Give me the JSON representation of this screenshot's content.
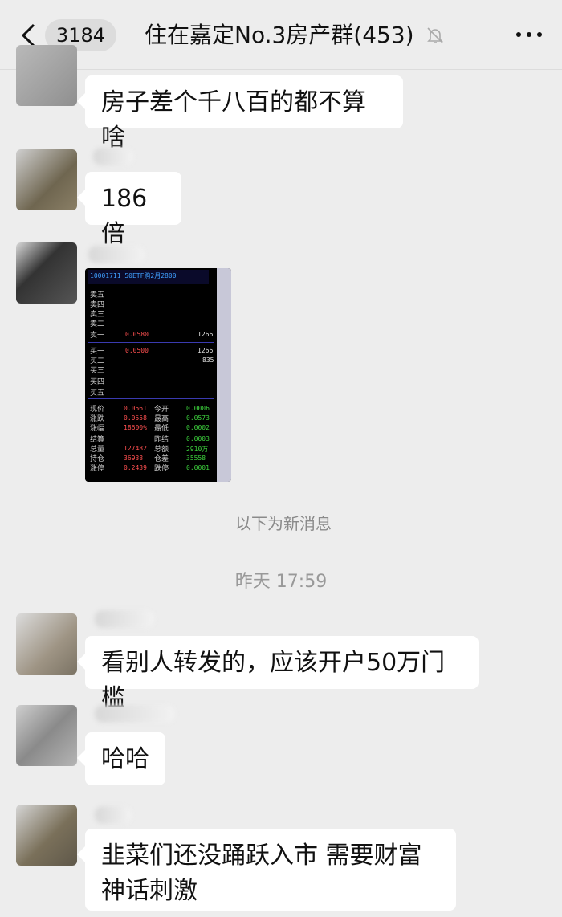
{
  "header": {
    "unread_count": "3184",
    "title": "住在嘉定No.3房产群(453)"
  },
  "messages_before": [
    {
      "text": "房子差个千八百的都不算啥"
    },
    {
      "text": "186倍"
    }
  ],
  "quote_image": {
    "title": "10001711 50ETF购2月2800",
    "sell_labels": [
      "卖五",
      "卖四",
      "卖三",
      "卖二",
      "卖一"
    ],
    "buy_labels": [
      "买一",
      "买二",
      "买三",
      "买四",
      "买五"
    ],
    "sell1_price": "0.0580",
    "sell1_volume": "1266",
    "buy1_price": "0.0500",
    "buy1_volume": "1266",
    "buy2_volume": "835",
    "stats": [
      {
        "label": "现价",
        "value": "0.0561",
        "label2": "今开",
        "value2": "0.0006"
      },
      {
        "label": "涨跌",
        "value": "0.0558",
        "label2": "最高",
        "value2": "0.0573"
      },
      {
        "label": "涨幅",
        "value": "18600%",
        "label2": "最低",
        "value2": "0.0002"
      },
      {
        "label": "结算",
        "value": "",
        "label2": "昨结",
        "value2": "0.0003"
      },
      {
        "label": "总量",
        "value": "127482",
        "label2": "总额",
        "value2": "2910万"
      },
      {
        "label": "持仓",
        "value": "36938",
        "label2": "仓差",
        "value2": "35558"
      },
      {
        "label": "涨停",
        "value": "0.2439",
        "label2": "跌停",
        "value2": "0.0001"
      }
    ]
  },
  "divider_text": "以下为新消息",
  "timestamp": "昨天 17:59",
  "messages_after": [
    {
      "text": "看别人转发的，应该开户50万门槛"
    },
    {
      "text": "哈哈"
    },
    {
      "text": "韭菜们还没踊跃入市 需要财富神话刺激"
    }
  ]
}
